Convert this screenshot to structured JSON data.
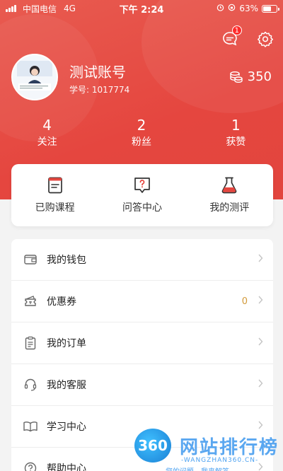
{
  "status_bar": {
    "carrier": "中国电信",
    "network": "4G",
    "time": "下午 2:24",
    "battery": "63%",
    "battery_level": 0.63
  },
  "header": {
    "message_badge": "1",
    "user_name": "测试账号",
    "student_id": "学号: 1017774",
    "points": "350",
    "brand_color": "#e5463f"
  },
  "stats": [
    {
      "value": "4",
      "label": "关注"
    },
    {
      "value": "2",
      "label": "粉丝"
    },
    {
      "value": "1",
      "label": "获赞"
    }
  ],
  "quick_actions": [
    {
      "label": "已购课程",
      "icon": "course-book-icon"
    },
    {
      "label": "问答中心",
      "icon": "qa-chat-icon"
    },
    {
      "label": "我的测评",
      "icon": "flask-icon"
    }
  ],
  "menu": [
    {
      "label": "我的钱包",
      "icon": "wallet-icon",
      "value": ""
    },
    {
      "label": "优惠券",
      "icon": "coupon-icon",
      "value": "0"
    },
    {
      "label": "我的订单",
      "icon": "order-clipboard-icon",
      "value": ""
    },
    {
      "label": "我的客服",
      "icon": "headset-icon",
      "value": ""
    },
    {
      "label": "学习中心",
      "icon": "open-book-icon",
      "value": ""
    },
    {
      "label": "帮助中心",
      "icon": "help-icon",
      "value": ""
    }
  ],
  "watermark": {
    "logo": "360",
    "title": "网站排行榜",
    "url": "-WANGZHAN360.CN-",
    "sub": "您的问题，我来解答"
  }
}
